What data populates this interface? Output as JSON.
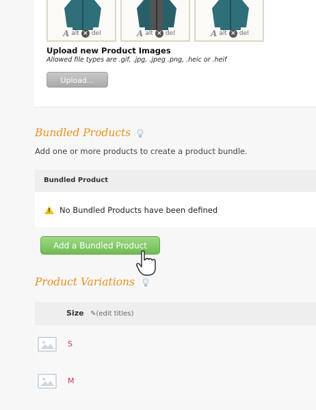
{
  "images": {
    "thumbs": [
      {
        "alt_label": "alt",
        "del_label": "del",
        "icon": "jacket-image"
      },
      {
        "alt_label": "alt",
        "del_label": "del",
        "icon": "jacket-image"
      },
      {
        "alt_label": "alt",
        "del_label": "del",
        "icon": "jacket-image"
      }
    ],
    "upload_title": "Upload new Product Images",
    "upload_note": "Allowed file types are .gif, .jpg, .jpeg .png, .heic or .heif",
    "upload_button": "Upload..."
  },
  "bundled": {
    "title": "Bundled Products",
    "description": "Add one or more products to create a product bundle.",
    "column_header": "Bundled Product",
    "empty_message": "No Bundled Products have been defined",
    "add_button": "Add a Bundled Product"
  },
  "variations": {
    "title": "Product Variations",
    "column": "Size",
    "edit_titles": "(edit titles)",
    "rows": [
      {
        "label": "S"
      },
      {
        "label": "M"
      }
    ]
  },
  "colors": {
    "accent": "#e8901e",
    "add_button": "#7cc462",
    "variation_label": "#c2354a"
  }
}
